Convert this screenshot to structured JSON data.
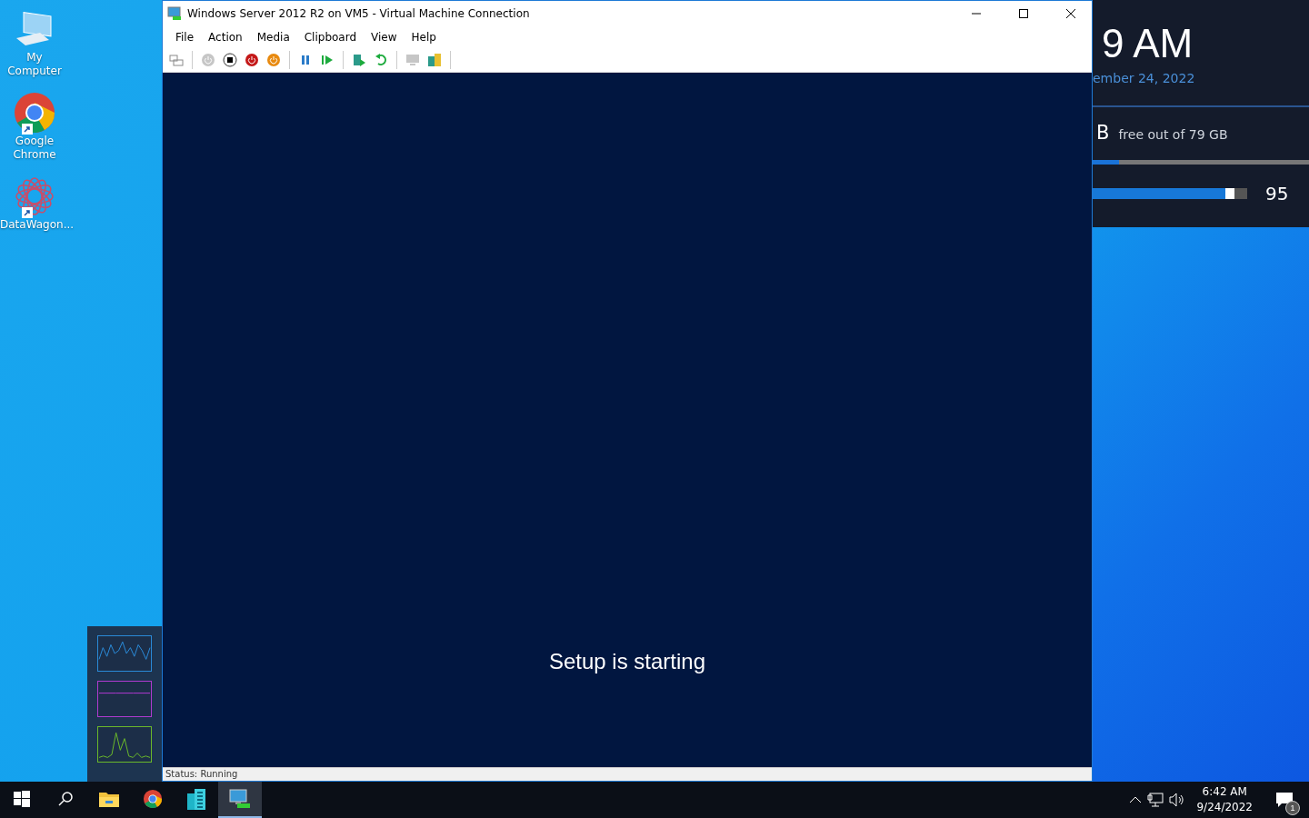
{
  "desktop_icons": [
    {
      "kind": "computer",
      "label": "My Computer",
      "shortcut": false
    },
    {
      "kind": "chrome",
      "label": "Google Chrome",
      "shortcut": true
    },
    {
      "kind": "datawagon",
      "label": "DataWagon...",
      "shortcut": true
    }
  ],
  "window": {
    "title": "Windows Server 2012 R2 on VM5 - Virtual Machine Connection",
    "menu": [
      "File",
      "Action",
      "Media",
      "Clipboard",
      "View",
      "Help"
    ],
    "toolbar_groups": [
      [
        {
          "kind": "ctrl-alt-del",
          "disabled": false
        }
      ],
      [
        {
          "kind": "start",
          "disabled": true
        },
        {
          "kind": "turn-off",
          "disabled": false
        },
        {
          "kind": "shut-down",
          "disabled": false
        },
        {
          "kind": "save",
          "disabled": false
        }
      ],
      [
        {
          "kind": "pause",
          "disabled": false
        },
        {
          "kind": "resume",
          "disabled": false
        }
      ],
      [
        {
          "kind": "checkpoint",
          "disabled": false
        },
        {
          "kind": "revert",
          "disabled": false
        }
      ],
      [
        {
          "kind": "enhanced",
          "disabled": true
        },
        {
          "kind": "share",
          "disabled": false
        }
      ]
    ],
    "screen_text": "Setup is starting",
    "status": "Status: Running"
  },
  "widget": {
    "time": "9 AM",
    "date": "ember 24, 2022",
    "disk_unit": "B",
    "disk_text": "free out of 79 GB",
    "disk": {
      "level": 0.12
    },
    "volume": {
      "level": 0.92,
      "reading": "95"
    }
  },
  "taskbar": {
    "apps": [
      {
        "kind": "explorer",
        "selected": false
      },
      {
        "kind": "chrome",
        "selected": false
      },
      {
        "kind": "building",
        "selected": false
      },
      {
        "kind": "hyperv",
        "selected": true
      }
    ],
    "time": "6:42 AM",
    "date": "9/24/2022",
    "notifications": "1"
  }
}
